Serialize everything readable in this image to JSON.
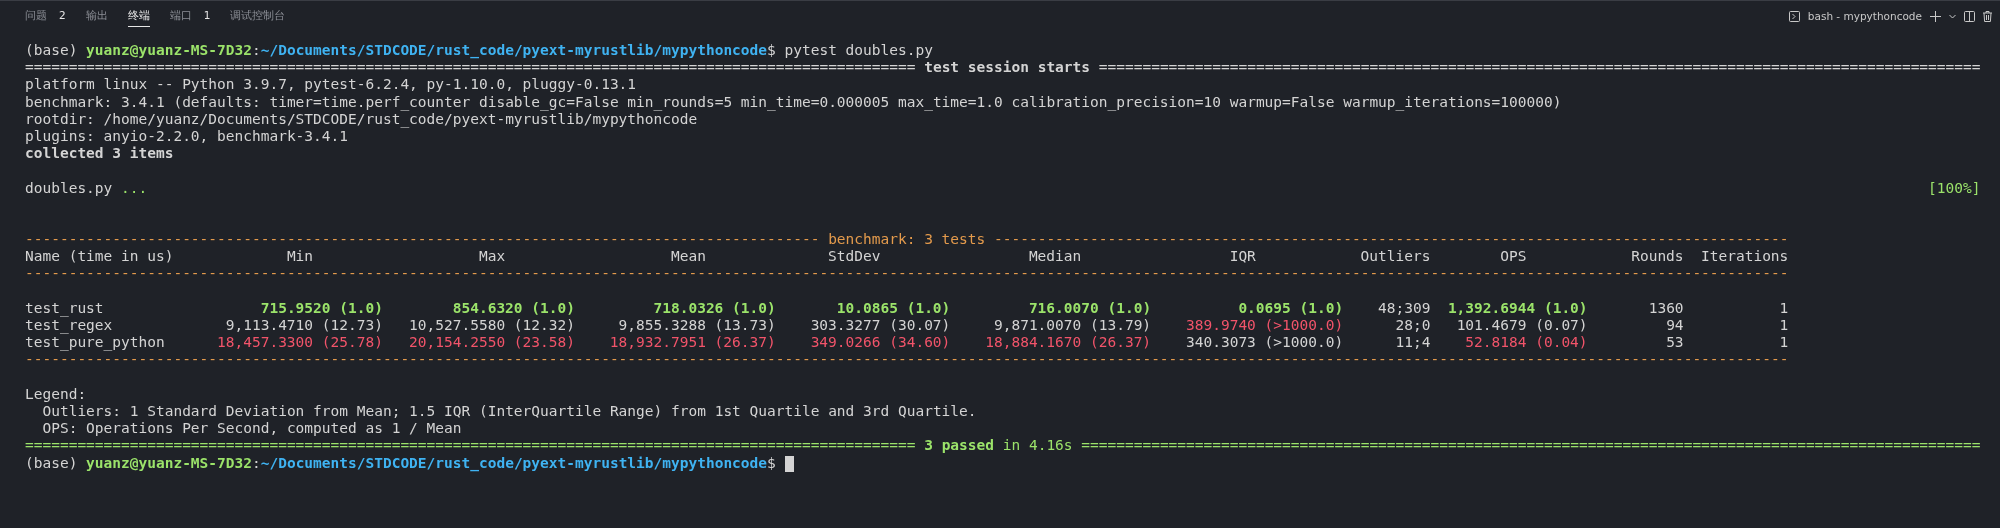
{
  "panel_tabs": [
    {
      "label": "问题",
      "count": "2",
      "selected": false
    },
    {
      "label": "输出",
      "selected": false
    },
    {
      "label": "终端",
      "selected": true
    },
    {
      "label": "端口",
      "count": "1",
      "selected": false
    },
    {
      "label": "调试控制台",
      "selected": false
    }
  ],
  "terminal_title": "bash - mypythoncode",
  "session_log": [
    {
      "kind": "text",
      "segments": [
        {
          "text": "(base) ",
          "kind": "text"
        },
        {
          "text": "yuanz@yuanz-MS-7D32",
          "kind": "user"
        },
        {
          "text": ":",
          "kind": "text"
        },
        {
          "text": "~/Documents/STDCODE/rust_code/pyext-myrustlib/mypythoncode",
          "kind": "path"
        },
        {
          "text": "$ pytest doubles.py",
          "kind": "text"
        }
      ]
    },
    {
      "kind": "rule",
      "segments": [
        {
          "text": "====================================================================================================== ",
          "kind": "text"
        },
        {
          "text": "test session starts",
          "kind": "heading"
        },
        {
          "text": " =====================================================================================================",
          "kind": "text"
        }
      ]
    },
    {
      "kind": "text",
      "segments": [
        {
          "text": "platform linux -- Python 3.9.7, pytest-6.2.4, py-1.10.0, pluggy-0.13.1",
          "kind": "text"
        }
      ]
    },
    {
      "kind": "text",
      "segments": [
        {
          "text": "benchmark: 3.4.1 (defaults: timer=time.perf_counter disable_gc=False min_rounds=5 min_time=0.000005 max_time=1.0 calibration_precision=10 warmup=False warmup_iterations=100000)",
          "kind": "text"
        }
      ]
    },
    {
      "kind": "text",
      "segments": [
        {
          "text": "rootdir: /home/yuanz/Documents/STDCODE/rust_code/pyext-myrustlib/mypythoncode",
          "kind": "text"
        }
      ]
    },
    {
      "kind": "text",
      "segments": [
        {
          "text": "plugins: anyio-2.2.0, benchmark-3.4.1",
          "kind": "text"
        }
      ]
    },
    {
      "kind": "text",
      "segments": [
        {
          "text": "collected 3 items",
          "kind": "heading"
        }
      ]
    },
    {
      "kind": "blank"
    },
    {
      "kind": "result",
      "segments": [
        {
          "text": "doubles.py ",
          "kind": "text"
        },
        {
          "text": "...",
          "kind": "dots"
        }
      ],
      "right": "[100%]"
    },
    {
      "kind": "blank"
    },
    {
      "kind": "blank"
    }
  ],
  "benchmark_table": {
    "title_rule": "------------------------------------------------------------------------------------------- benchmark: 3 tests -------------------------------------------------------------------------------------------",
    "columns": [
      "Name (time in us)",
      "Min",
      "Max",
      "Mean",
      "StdDev",
      "Median",
      "IQR",
      "Outliers",
      "OPS",
      "Rounds",
      "Iterations"
    ],
    "header_rule": "----------------------------------------------------------------------------------------------------------------------------------------------------------------------------------------------------------",
    "rows": [
      {
        "cells": [
          {
            "text": "test_rust",
            "kind": "normal"
          },
          {
            "text": "715.9520 (1.0)",
            "kind": "best"
          },
          {
            "text": "854.6320 (1.0)",
            "kind": "best"
          },
          {
            "text": "718.0326 (1.0)",
            "kind": "best"
          },
          {
            "text": "10.0865 (1.0)",
            "kind": "best"
          },
          {
            "text": "716.0070 (1.0)",
            "kind": "best"
          },
          {
            "text": "0.0695 (1.0)",
            "kind": "best"
          },
          {
            "text": "48;309",
            "kind": "normal"
          },
          {
            "text": "1,392.6944 (1.0)",
            "kind": "best"
          },
          {
            "text": "1360",
            "kind": "normal"
          },
          {
            "text": "1",
            "kind": "normal"
          }
        ]
      },
      {
        "cells": [
          {
            "text": "test_regex",
            "kind": "normal"
          },
          {
            "text": "9,113.4710 (12.73)",
            "kind": "normal"
          },
          {
            "text": "10,527.5580 (12.32)",
            "kind": "normal"
          },
          {
            "text": "9,855.3288 (13.73)",
            "kind": "normal"
          },
          {
            "text": "303.3277 (30.07)",
            "kind": "normal"
          },
          {
            "text": "9,871.0070 (13.79)",
            "kind": "normal"
          },
          {
            "text": "389.9740 (>1000.0)",
            "kind": "worst"
          },
          {
            "text": "28;0",
            "kind": "normal"
          },
          {
            "text": "101.4679 (0.07)",
            "kind": "normal"
          },
          {
            "text": "94",
            "kind": "normal"
          },
          {
            "text": "1",
            "kind": "normal"
          }
        ]
      },
      {
        "cells": [
          {
            "text": "test_pure_python",
            "kind": "normal"
          },
          {
            "text": "18,457.3300 (25.78)",
            "kind": "worst"
          },
          {
            "text": "20,154.2550 (23.58)",
            "kind": "worst"
          },
          {
            "text": "18,932.7951 (26.37)",
            "kind": "worst"
          },
          {
            "text": "349.0266 (34.60)",
            "kind": "worst"
          },
          {
            "text": "18,884.1670 (26.37)",
            "kind": "worst"
          },
          {
            "text": "340.3073 (>1000.0)",
            "kind": "normal"
          },
          {
            "text": "11;4",
            "kind": "normal"
          },
          {
            "text": "52.8184 (0.04)",
            "kind": "worst"
          },
          {
            "text": "53",
            "kind": "normal"
          },
          {
            "text": "1",
            "kind": "normal"
          }
        ]
      }
    ],
    "bottom_rule": "----------------------------------------------------------------------------------------------------------------------------------------------------------------------------------------------------------"
  },
  "footer_log": [
    {
      "kind": "blank"
    },
    {
      "kind": "text",
      "segments": [
        {
          "text": "Legend:",
          "kind": "text"
        }
      ]
    },
    {
      "kind": "text",
      "segments": [
        {
          "text": "  Outliers: 1 Standard Deviation from Mean; 1.5 IQR (InterQuartile Range) from 1st Quartile and 3rd Quartile.",
          "kind": "text"
        }
      ]
    },
    {
      "kind": "text",
      "segments": [
        {
          "text": "  OPS: Operations Per Second, computed as 1 / Mean",
          "kind": "text"
        }
      ]
    },
    {
      "kind": "rule",
      "segments": [
        {
          "text": "====================================================================================================== ",
          "kind": "success"
        },
        {
          "text": "3 passed",
          "kind": "passed"
        },
        {
          "text": " in 4.16s =======================================================================================================",
          "kind": "success"
        }
      ]
    },
    {
      "kind": "prompt",
      "segments": [
        {
          "text": "(base) ",
          "kind": "text"
        },
        {
          "text": "yuanz@yuanz-MS-7D32",
          "kind": "user"
        },
        {
          "text": ":",
          "kind": "text"
        },
        {
          "text": "~/Documents/STDCODE/rust_code/pyext-myrustlib/mypythoncode",
          "kind": "path"
        },
        {
          "text": "$ ",
          "kind": "text"
        }
      ]
    }
  ]
}
